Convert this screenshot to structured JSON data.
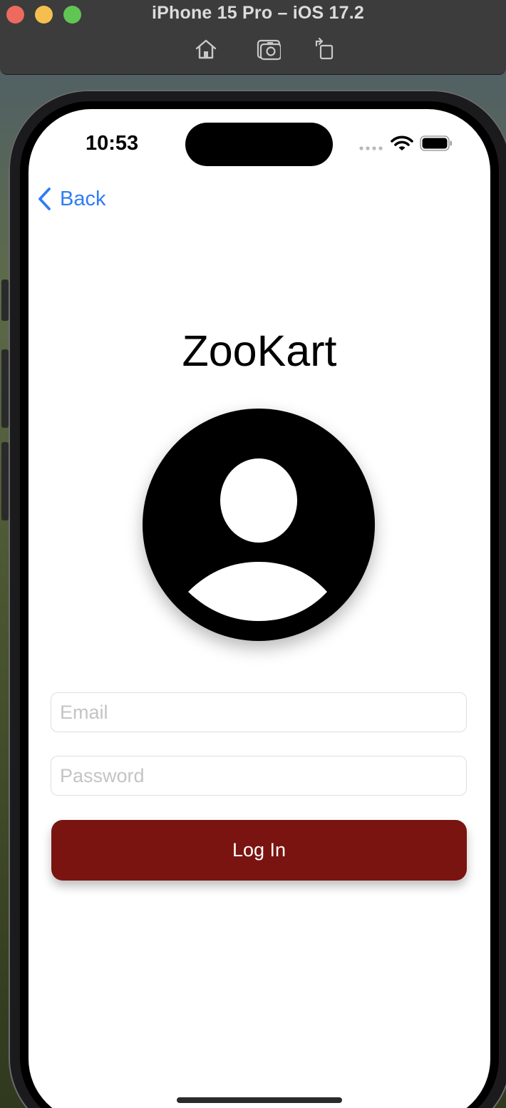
{
  "simulator": {
    "title": "iPhone 15 Pro – iOS 17.2",
    "toolbar": [
      {
        "icon": "home-icon"
      },
      {
        "icon": "screenshot-icon"
      },
      {
        "icon": "rotate-icon"
      }
    ]
  },
  "status_bar": {
    "time": "10:53"
  },
  "nav": {
    "back_label": "Back"
  },
  "login": {
    "app_title": "ZooKart",
    "avatar_icon": "person-circle-icon",
    "email_placeholder": "Email",
    "email_value": "",
    "password_placeholder": "Password",
    "password_value": "",
    "login_label": "Log In"
  },
  "colors": {
    "accent": "#2f7cf6",
    "login_button": "#7a1410"
  }
}
